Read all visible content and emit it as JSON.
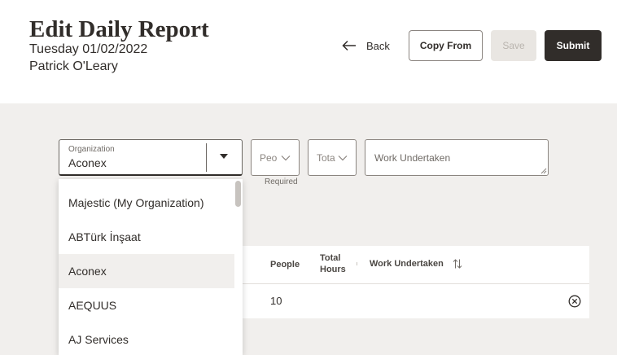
{
  "header": {
    "title": "Edit Daily Report",
    "date": "Tuesday 01/02/2022",
    "user": "Patrick O'Leary",
    "back_label": "Back",
    "copy_from_label": "Copy From",
    "save_label": "Save",
    "submit_label": "Submit"
  },
  "form": {
    "organization": {
      "label": "Organization",
      "value": "Aconex"
    },
    "people": {
      "placeholder": "Peo",
      "helper": "Required"
    },
    "total_hours": {
      "placeholder": "Tota"
    },
    "work_undertaken": {
      "placeholder": "Work Undertaken"
    }
  },
  "table": {
    "columns": {
      "people": "People",
      "total_hours_line1": "Total",
      "total_hours_line2": "Hours",
      "work_undertaken": "Work Undertaken"
    },
    "rows": [
      {
        "people": "10"
      }
    ]
  },
  "dropdown": {
    "options": [
      "Majestic (My Organization)",
      "ABTürk İnşaat",
      "Aconex",
      "AEQUUS",
      "AJ Services"
    ],
    "selected": "Aconex"
  },
  "colors": {
    "primary_dark": "#312d2a",
    "background": "#f1efed",
    "disabled": "#e9e6e2"
  }
}
